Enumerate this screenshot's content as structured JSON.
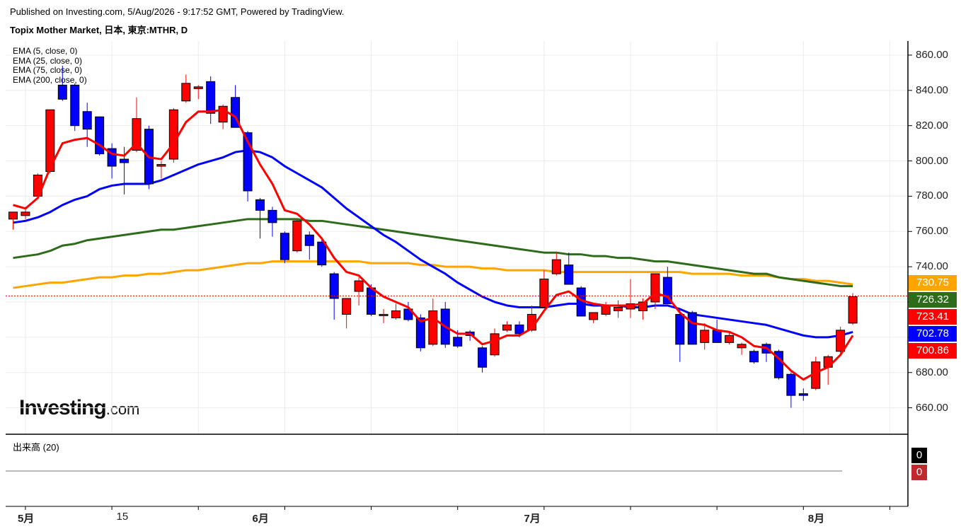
{
  "header": {
    "published": "Published on Investing.com, 5/Aug/2026 - 9:17:52 GMT, Powered by TradingView.",
    "title": "Topix Mother Market, 日本, 東京:MTHR, D"
  },
  "ema_legend": [
    "EMA (5, close, 0)",
    "EMA (25, close, 0)",
    "EMA (75, close, 0)",
    "EMA (200, close, 0)"
  ],
  "volume_label": "出来高 (20)",
  "logo": {
    "main": "Investing",
    "suffix": ".com"
  },
  "colors": {
    "up": "#ff0000",
    "down": "#0000ff",
    "ema5": "#ff0000",
    "ema25": "#0000ff",
    "ema75": "#2e6b1a",
    "ema200": "#ffa500",
    "current_line": "#ff0000"
  },
  "chart_data": {
    "type": "candlestick",
    "ylim": [
      645,
      868
    ],
    "y_ticks": [
      "860.00",
      "840.00",
      "820.00",
      "800.00",
      "780.00",
      "760.00",
      "740.00",
      "720.00",
      "700.00",
      "680.00",
      "660.00"
    ],
    "x_labels": [
      {
        "label": "5月",
        "index": 1,
        "bold": true
      },
      {
        "label": "15",
        "index": 9,
        "bold": false
      },
      {
        "label": "6月",
        "index": 20,
        "bold": true
      },
      {
        "label": "7月",
        "index": 42,
        "bold": true
      },
      {
        "label": "8月",
        "index": 65,
        "bold": true
      }
    ],
    "candles": [
      {
        "o": 767,
        "h": 771,
        "l": 761,
        "c": 771
      },
      {
        "o": 769,
        "h": 774,
        "l": 767,
        "c": 771
      },
      {
        "o": 780,
        "h": 793,
        "l": 779,
        "c": 792
      },
      {
        "o": 794,
        "h": 829,
        "l": 793,
        "c": 829
      },
      {
        "o": 843,
        "h": 854,
        "l": 834,
        "c": 835
      },
      {
        "o": 843,
        "h": 844,
        "l": 817,
        "c": 820
      },
      {
        "o": 828,
        "h": 833,
        "l": 808,
        "c": 818
      },
      {
        "o": 825,
        "h": 825,
        "l": 803,
        "c": 804
      },
      {
        "o": 807,
        "h": 810,
        "l": 790,
        "c": 797
      },
      {
        "o": 801,
        "h": 808,
        "l": 781,
        "c": 799
      },
      {
        "o": 806,
        "h": 836,
        "l": 805,
        "c": 824
      },
      {
        "o": 818,
        "h": 820,
        "l": 784,
        "c": 787
      },
      {
        "o": 797,
        "h": 800,
        "l": 790,
        "c": 798
      },
      {
        "o": 801,
        "h": 830,
        "l": 799,
        "c": 829
      },
      {
        "o": 834,
        "h": 849,
        "l": 833,
        "c": 844
      },
      {
        "o": 841,
        "h": 843,
        "l": 835,
        "c": 842
      },
      {
        "o": 845,
        "h": 848,
        "l": 821,
        "c": 827
      },
      {
        "o": 822,
        "h": 832,
        "l": 818,
        "c": 831
      },
      {
        "o": 836,
        "h": 843,
        "l": 819,
        "c": 819
      },
      {
        "o": 816,
        "h": 817,
        "l": 777,
        "c": 783
      },
      {
        "o": 778,
        "h": 779,
        "l": 756,
        "c": 772
      },
      {
        "o": 772,
        "h": 774,
        "l": 757,
        "c": 765
      },
      {
        "o": 759,
        "h": 760,
        "l": 742,
        "c": 744
      },
      {
        "o": 749,
        "h": 767,
        "l": 748,
        "c": 766
      },
      {
        "o": 758,
        "h": 760,
        "l": 744,
        "c": 752
      },
      {
        "o": 754,
        "h": 756,
        "l": 740,
        "c": 741
      },
      {
        "o": 736,
        "h": 737,
        "l": 710,
        "c": 722
      },
      {
        "o": 713,
        "h": 722,
        "l": 705,
        "c": 722
      },
      {
        "o": 726,
        "h": 734,
        "l": 718,
        "c": 732
      },
      {
        "o": 728,
        "h": 730,
        "l": 712,
        "c": 713
      },
      {
        "o": 713,
        "h": 716,
        "l": 708,
        "c": 713
      },
      {
        "o": 711,
        "h": 719,
        "l": 710,
        "c": 715
      },
      {
        "o": 716,
        "h": 720,
        "l": 709,
        "c": 710
      },
      {
        "o": 711,
        "h": 713,
        "l": 692,
        "c": 694
      },
      {
        "o": 696,
        "h": 722,
        "l": 695,
        "c": 715
      },
      {
        "o": 716,
        "h": 720,
        "l": 694,
        "c": 696
      },
      {
        "o": 700,
        "h": 704,
        "l": 694,
        "c": 695
      },
      {
        "o": 703,
        "h": 704,
        "l": 698,
        "c": 701
      },
      {
        "o": 694,
        "h": 695,
        "l": 680,
        "c": 683
      },
      {
        "o": 690,
        "h": 705,
        "l": 689,
        "c": 702
      },
      {
        "o": 704,
        "h": 709,
        "l": 703,
        "c": 707
      },
      {
        "o": 707,
        "h": 709,
        "l": 700,
        "c": 702
      },
      {
        "o": 704,
        "h": 718,
        "l": 703,
        "c": 713
      },
      {
        "o": 717,
        "h": 738,
        "l": 717,
        "c": 733
      },
      {
        "o": 736,
        "h": 748,
        "l": 735,
        "c": 744
      },
      {
        "o": 741,
        "h": 748,
        "l": 730,
        "c": 730
      },
      {
        "o": 728,
        "h": 729,
        "l": 712,
        "c": 712
      },
      {
        "o": 710,
        "h": 714,
        "l": 708,
        "c": 714
      },
      {
        "o": 713,
        "h": 720,
        "l": 712,
        "c": 718
      },
      {
        "o": 715,
        "h": 721,
        "l": 711,
        "c": 717
      },
      {
        "o": 716,
        "h": 733,
        "l": 711,
        "c": 719
      },
      {
        "o": 715,
        "h": 722,
        "l": 710,
        "c": 720
      },
      {
        "o": 720,
        "h": 736,
        "l": 716,
        "c": 736
      },
      {
        "o": 734,
        "h": 740,
        "l": 719,
        "c": 719
      },
      {
        "o": 713,
        "h": 716,
        "l": 686,
        "c": 696
      },
      {
        "o": 714,
        "h": 715,
        "l": 696,
        "c": 696
      },
      {
        "o": 697,
        "h": 708,
        "l": 693,
        "c": 704
      },
      {
        "o": 704,
        "h": 710,
        "l": 697,
        "c": 697
      },
      {
        "o": 697,
        "h": 703,
        "l": 696,
        "c": 701
      },
      {
        "o": 694,
        "h": 697,
        "l": 690,
        "c": 696
      },
      {
        "o": 692,
        "h": 693,
        "l": 685,
        "c": 686
      },
      {
        "o": 696,
        "h": 697,
        "l": 686,
        "c": 691
      },
      {
        "o": 692,
        "h": 693,
        "l": 676,
        "c": 677
      },
      {
        "o": 679,
        "h": 680,
        "l": 660,
        "c": 667
      },
      {
        "o": 668,
        "h": 671,
        "l": 664,
        "c": 667
      },
      {
        "o": 671,
        "h": 689,
        "l": 670,
        "c": 686
      },
      {
        "o": 683,
        "h": 690,
        "l": 673,
        "c": 689
      },
      {
        "o": 692,
        "h": 706,
        "l": 691,
        "c": 704
      },
      {
        "o": 708,
        "h": 725,
        "l": 707,
        "c": 723
      }
    ],
    "series": [
      {
        "name": "EMA (5, close, 0)",
        "values": [
          775,
          773,
          779,
          796,
          810,
          812,
          813,
          809,
          804,
          803,
          810,
          802,
          801,
          810,
          822,
          828,
          828,
          829,
          825,
          811,
          798,
          787,
          772,
          770,
          764,
          756,
          745,
          737,
          735,
          728,
          723,
          720,
          717,
          709,
          711,
          706,
          702,
          702,
          696,
          698,
          701,
          701,
          705,
          715,
          724,
          726,
          721,
          719,
          718,
          718,
          718,
          719,
          725,
          723,
          714,
          708,
          707,
          704,
          703,
          700,
          695,
          694,
          688,
          681,
          676,
          680,
          683,
          690,
          701
        ]
      },
      {
        "name": "EMA (25, close, 0)",
        "values": [
          765,
          766,
          768,
          771,
          775,
          778,
          780,
          784,
          786,
          787,
          787,
          787,
          789,
          792,
          795,
          798,
          800,
          802,
          805,
          806,
          805,
          802,
          797,
          793,
          789,
          785,
          779,
          773,
          768,
          763,
          758,
          754,
          749,
          744,
          740,
          736,
          731,
          727,
          723,
          720,
          718,
          717,
          717,
          717,
          718,
          719,
          719,
          718,
          718,
          718,
          717,
          717,
          718,
          718,
          716,
          713,
          712,
          711,
          710,
          709,
          708,
          707,
          705,
          703,
          701,
          700,
          700,
          701,
          703
        ]
      },
      {
        "name": "EMA (75, close, 0)",
        "values": [
          745,
          746,
          747,
          749,
          752,
          753,
          755,
          756,
          757,
          758,
          759,
          760,
          761,
          761,
          762,
          763,
          764,
          765,
          766,
          767,
          767,
          767,
          767,
          767,
          766,
          766,
          765,
          764,
          763,
          762,
          761,
          760,
          759,
          758,
          757,
          756,
          755,
          754,
          753,
          752,
          751,
          750,
          749,
          748,
          748,
          747,
          747,
          746,
          746,
          745,
          745,
          744,
          743,
          743,
          742,
          741,
          740,
          739,
          738,
          737,
          736,
          736,
          734,
          733,
          732,
          731,
          730,
          729,
          729
        ]
      },
      {
        "name": "EMA (200, close, 0)",
        "values": [
          728,
          729,
          730,
          731,
          731,
          732,
          733,
          734,
          734,
          735,
          735,
          736,
          736,
          737,
          738,
          738,
          739,
          740,
          741,
          742,
          742,
          743,
          743,
          743,
          743,
          743,
          743,
          743,
          743,
          742,
          742,
          742,
          742,
          741,
          741,
          740,
          740,
          740,
          739,
          739,
          738,
          738,
          738,
          738,
          737,
          737,
          737,
          737,
          737,
          737,
          737,
          737,
          737,
          737,
          737,
          736,
          736,
          736,
          736,
          735,
          735,
          735,
          734,
          733,
          733,
          732,
          732,
          731,
          730
        ]
      }
    ],
    "price_tags": [
      {
        "value": 730.75,
        "label": "730.75",
        "color": "#ffa500"
      },
      {
        "value": 726.32,
        "label": "726.32",
        "color": "#2e6b1a"
      },
      {
        "value": 723.41,
        "label": "723.41",
        "color": "#ff0000"
      },
      {
        "value": 702.78,
        "label": "702.78",
        "color": "#0000ff"
      },
      {
        "value": 700.86,
        "label": "700.86",
        "color": "#ff0000"
      }
    ],
    "current_price": 723.41,
    "volume_tags": [
      {
        "label": "0",
        "color": "#000000"
      },
      {
        "label": "0",
        "color": "#c0282d"
      }
    ]
  }
}
